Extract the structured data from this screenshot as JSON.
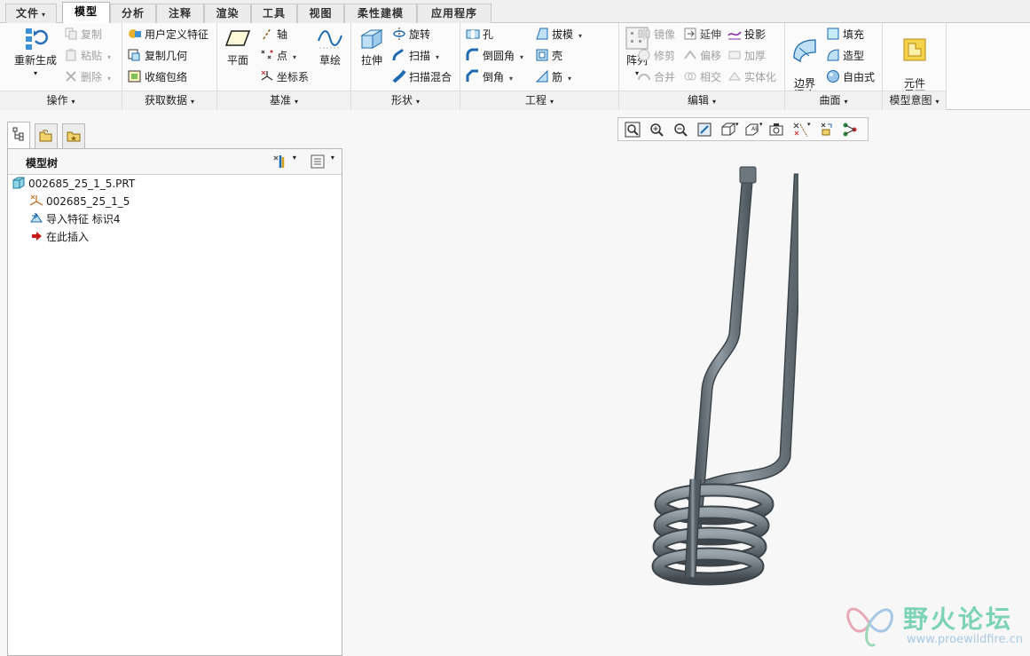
{
  "tabs": [
    {
      "label": "文件",
      "caret": "▾"
    },
    {
      "label": "模型"
    },
    {
      "label": "分析"
    },
    {
      "label": "注释"
    },
    {
      "label": "渲染"
    },
    {
      "label": "工具"
    },
    {
      "label": "视图"
    },
    {
      "label": "柔性建模"
    },
    {
      "label": "应用程序"
    }
  ],
  "ribbon": {
    "operations": {
      "footer": "操作",
      "regen": "重新生成",
      "copy": "复制",
      "paste": "粘贴",
      "delete": "删除"
    },
    "get_data": {
      "footer": "获取数据",
      "udf": "用户定义特征",
      "copy_geom": "复制几何",
      "shrinkwrap": "收缩包络"
    },
    "datum": {
      "footer": "基准",
      "plane": "平面",
      "axis": "轴",
      "point": "点",
      "csys": "坐标系",
      "sketch": "草绘"
    },
    "shapes": {
      "footer": "形状",
      "extrude": "拉伸",
      "revolve": "旋转",
      "sweep": "扫描",
      "swept_blend": "扫描混合"
    },
    "engineering": {
      "footer": "工程",
      "hole": "孔",
      "round": "倒圆角",
      "chamfer": "倒角",
      "draft": "拔模",
      "shell": "壳",
      "rib": "筋"
    },
    "editing": {
      "footer": "编辑",
      "pattern": "阵列",
      "mirror": "镜像",
      "trim": "修剪",
      "merge": "合并",
      "extend": "延伸",
      "offset": "偏移",
      "intersect": "相交",
      "project": "投影",
      "thicken": "加厚",
      "solidify": "实体化"
    },
    "surfaces": {
      "footer": "曲面",
      "boundary_blend": "边界\n混合",
      "fill": "填充",
      "style": "造型",
      "freestyle": "自由式"
    },
    "intent": {
      "footer": "模型意图",
      "component_interface": "元件\n界面"
    }
  },
  "model_tree": {
    "title": "模型树",
    "items": [
      {
        "label": "002685_25_1_5.PRT"
      },
      {
        "label": "002685_25_1_5"
      },
      {
        "label": "导入特征 标识4"
      },
      {
        "label": "在此插入"
      }
    ]
  },
  "watermark": {
    "name": "野火论坛",
    "url": "www.proewildfire.cn"
  },
  "colors": {
    "accent": "#2b7bd6",
    "model": "#6f7a82",
    "watermark": "#7dd3b5"
  }
}
